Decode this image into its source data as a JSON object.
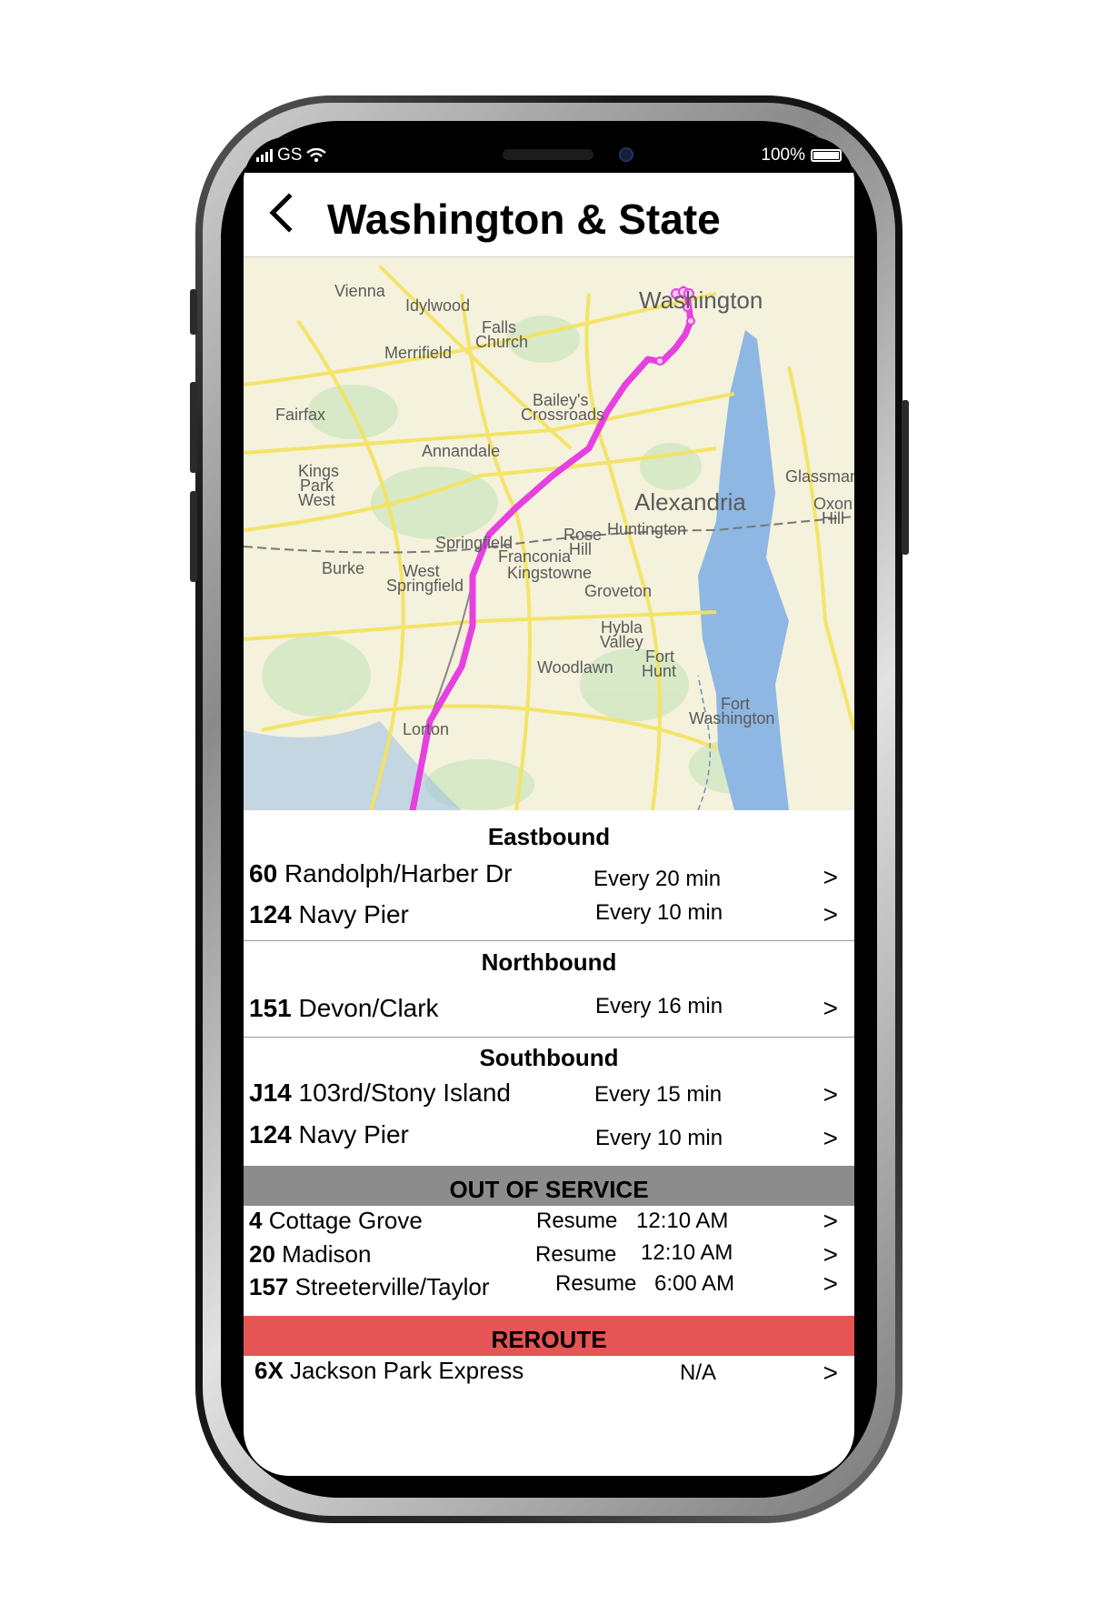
{
  "status_bar": {
    "carrier": "GS",
    "battery": "100%"
  },
  "header": {
    "back_icon": "chevron-left-icon",
    "title": "Washington & State"
  },
  "map": {
    "labels": [
      "Vienna",
      "Idylwood",
      "Falls",
      "Church",
      "Merrifield",
      "Washington",
      "Fairfax",
      "Bailey's",
      "Crossroads",
      "Annandale",
      "Kings",
      "Park",
      "West",
      "Glassmanor",
      "Alexandria",
      "Oxon",
      "Hill",
      "Springfield",
      "Rose",
      "Hill",
      "Huntington",
      "Franconia",
      "Kingstowne",
      "Burke",
      "West",
      "Springfield",
      "Groveton",
      "Hybla",
      "Valley",
      "Woodlawn",
      "Fort",
      "Hunt",
      "Fort",
      "Washington",
      "Lorton"
    ],
    "route_color": "#e640e0"
  },
  "sections": [
    {
      "heading": "Eastbound",
      "rows": [
        {
          "num": "60",
          "name": "Randolph/Harber Dr",
          "freq": "Every 20 min"
        },
        {
          "num": "124",
          "name": "Navy Pier",
          "freq": "Every 10 min"
        }
      ]
    },
    {
      "heading": "Northbound",
      "rows": [
        {
          "num": "151",
          "name": "Devon/Clark",
          "freq": "Every 16 min"
        }
      ]
    },
    {
      "heading": "Southbound",
      "rows": [
        {
          "num": "J14",
          "name": "103rd/Stony Island",
          "freq": "Every 15 min"
        },
        {
          "num": "124",
          "name": "Navy Pier",
          "freq": "Every 10 min"
        }
      ]
    }
  ],
  "out_of_service": {
    "heading": "OUT OF SERVICE",
    "color": "#8c8c8c",
    "rows": [
      {
        "num": "4",
        "name": "Cottage Grove",
        "label": "Resume",
        "time": "12:10 AM"
      },
      {
        "num": "20",
        "name": "Madison",
        "label": "Resume",
        "time": "12:10 AM"
      },
      {
        "num": "157",
        "name": "Streeterville/Taylor",
        "label": "Resume",
        "time": "6:00 AM"
      }
    ]
  },
  "reroute": {
    "heading": "REROUTE",
    "color": "#e55555",
    "rows": [
      {
        "num": "6X",
        "name": "Jackson Park Express",
        "status": "N/A"
      }
    ]
  },
  "chevron": ">"
}
